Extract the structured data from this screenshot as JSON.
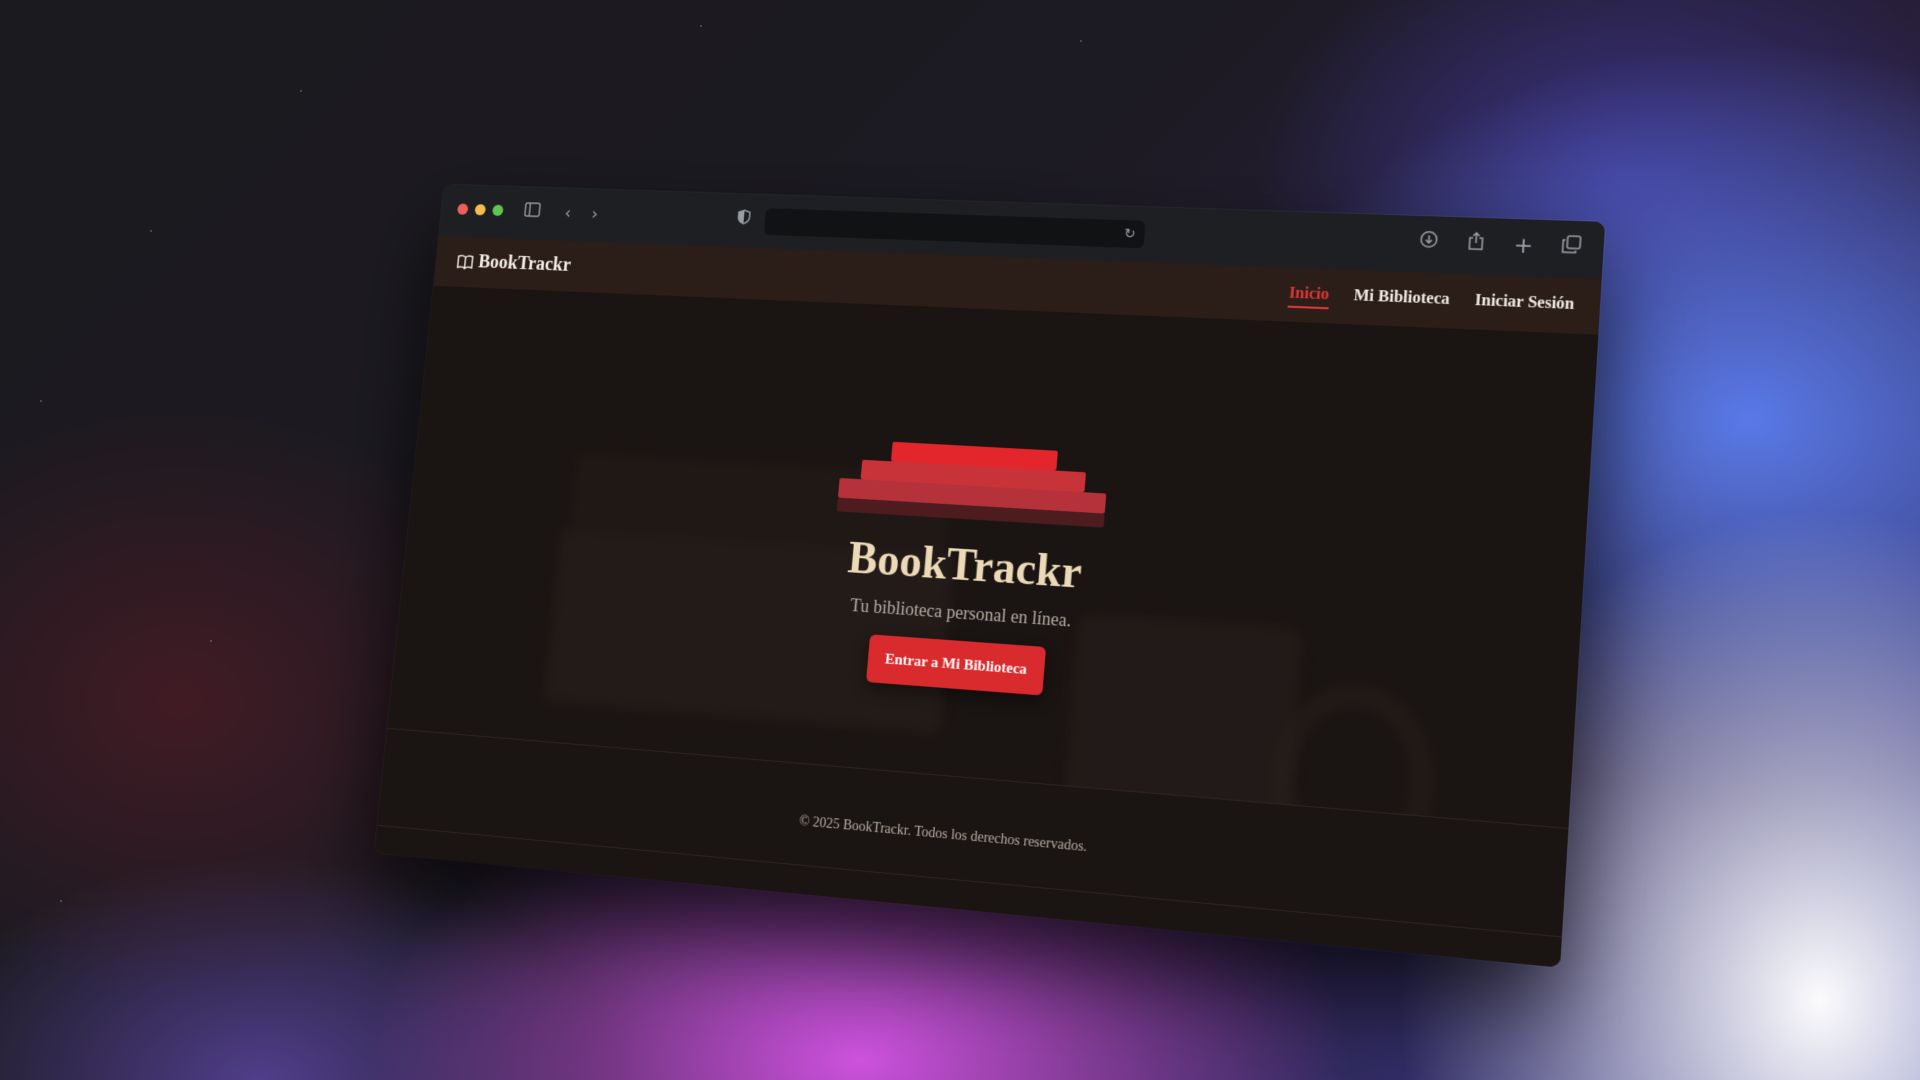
{
  "app": {
    "brand": "BookTrackr"
  },
  "nav": {
    "items": [
      {
        "label": "Inicio",
        "active": true
      },
      {
        "label": "Mi Biblioteca",
        "active": false
      },
      {
        "label": "Iniciar Sesión",
        "active": false
      }
    ]
  },
  "hero": {
    "title": "BookTrackr",
    "subtitle": "Tu biblioteca personal en línea.",
    "cta_label": "Entrar a Mi Biblioteca"
  },
  "footer": {
    "text": "© 2025 BookTrackr. Todos los derechos reservados."
  },
  "colors": {
    "accent": "#d92a2d",
    "title": "#ecd9b8",
    "nav_bg": "#2b1d18",
    "page_bg": "#1a1412"
  },
  "icons": {
    "traffic_lights": [
      "close-icon",
      "minimize-icon",
      "zoom-icon"
    ],
    "toolbar_left": [
      "sidebar-icon",
      "back-icon",
      "forward-icon"
    ],
    "toolbar_right": [
      "download-icon",
      "share-icon",
      "new-tab-icon",
      "tabs-overview-icon"
    ],
    "address": [
      "shield-icon",
      "reload-icon"
    ],
    "brand": "book-open-icon"
  }
}
